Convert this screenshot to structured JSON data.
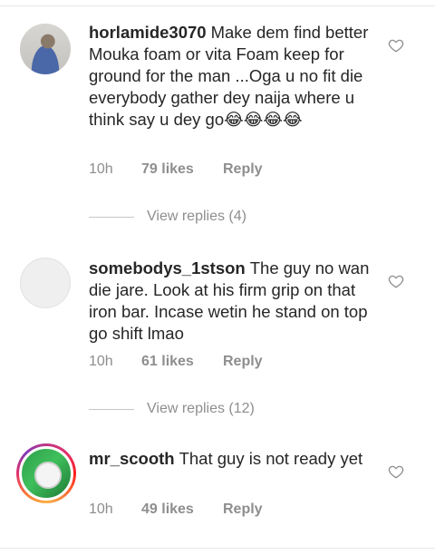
{
  "comments": [
    {
      "username": "horlamide3070",
      "text": "Make dem find better Mouka foam or vita Foam keep for ground for the man ...Oga u no fit die everybody gather dey naija where u think say u dey go😂😂😂😂",
      "time": "10h",
      "likes": "79 likes",
      "reply": "Reply",
      "view_replies": "View replies (4)"
    },
    {
      "username": "somebodys_1stson",
      "text": "The guy no wan die jare. Look at his firm grip on that iron bar. Incase wetin he stand on top go shift lmao",
      "time": "10h",
      "likes": "61 likes",
      "reply": "Reply",
      "view_replies": "View replies (12)"
    },
    {
      "username": "mr_scooth",
      "text": "That guy is not ready yet",
      "time": "10h",
      "likes": "49 likes",
      "reply": "Reply"
    }
  ],
  "icons": {
    "like": "heart-outline-icon"
  },
  "colors": {
    "text": "#262626",
    "secondary": "#8e8e8e",
    "divider": "#e6e6e6"
  }
}
